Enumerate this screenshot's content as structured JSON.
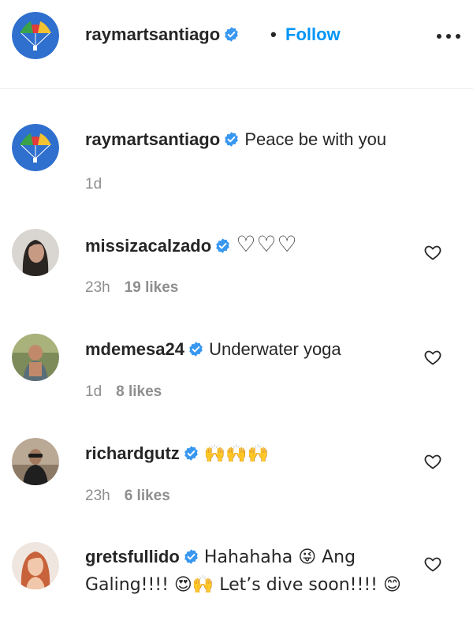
{
  "header": {
    "username": "raymartsantiago",
    "separator": "•",
    "follow_label": "Follow"
  },
  "caption": {
    "username": "raymartsantiago",
    "text": "Peace be with you",
    "time": "1d"
  },
  "comments": [
    {
      "username": "missizacalzado",
      "text": "♡♡♡",
      "time": "23h",
      "likes": "19 likes"
    },
    {
      "username": "mdemesa24",
      "text": "Underwater yoga",
      "time": "1d",
      "likes": "8 likes"
    },
    {
      "username": "richardgutz",
      "text": "🙌🙌🙌",
      "time": "23h",
      "likes": "6 likes"
    },
    {
      "username": "gretsfullido",
      "text": "Hahahaha 😜 Ang Galing!!!! 😍🙌 Let’s dive soon!!!! 😊",
      "time": "",
      "likes": ""
    }
  ],
  "colors": {
    "accent": "#0095f6",
    "text": "#262626",
    "muted": "#8e8e8e",
    "verified": "#3897f0"
  },
  "icons": {
    "verified": "verified-badge-icon",
    "heart": "heart-outline-icon",
    "more": "more-horizontal-icon"
  }
}
